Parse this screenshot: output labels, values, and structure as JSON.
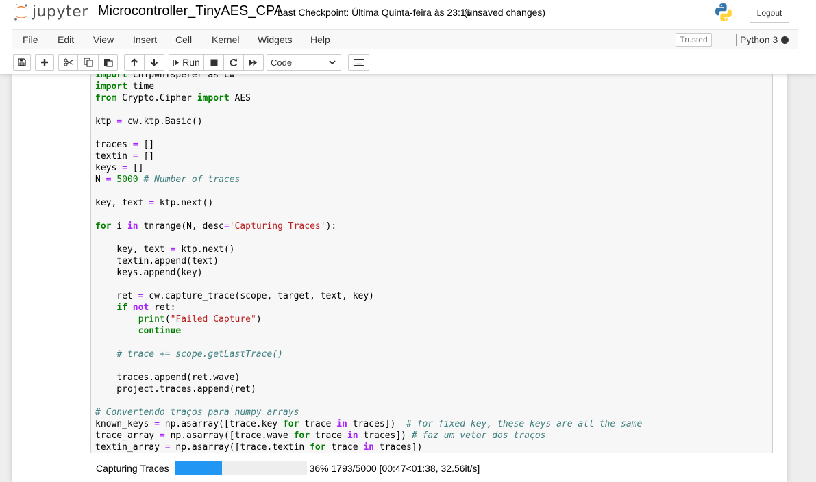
{
  "header": {
    "logo_text": "jupyter",
    "notebook_name": "Microcontroller_TinyAES_CPA",
    "checkpoint": "Last Checkpoint: Última Quinta-feira às 23:16",
    "unsaved": "(unsaved changes)",
    "logout_label": "Logout"
  },
  "menubar": {
    "items": [
      "File",
      "Edit",
      "View",
      "Insert",
      "Cell",
      "Kernel",
      "Widgets",
      "Help"
    ],
    "trusted_label": "Trusted",
    "kernel_name": "Python 3"
  },
  "toolbar": {
    "run_label": "Run",
    "cell_type": "Code",
    "icons": [
      "save-icon",
      "plus-icon",
      "cut-icon",
      "copy-icon",
      "paste-icon",
      "arrow-up-icon",
      "arrow-down-icon",
      "step-forward-icon",
      "stop-icon",
      "restart-icon",
      "fast-forward-icon",
      "chevron-down-icon",
      "keyboard-icon"
    ]
  },
  "colors": {
    "progress": "#2196f3",
    "keyword": "#008000",
    "operator": "#aa22ff",
    "string": "#ba2121",
    "comment": "#408080"
  },
  "code_lines": [
    "import chipwhisperer as cw",
    "import time",
    "from Crypto.Cipher import AES",
    "",
    "ktp = cw.ktp.Basic()",
    "",
    "traces = []",
    "textin = []",
    "keys = []",
    "N = 5000 # Number of traces",
    "",
    "key, text = ktp.next()",
    "",
    "for i in tnrange(N, desc='Capturing Traces'):",
    "",
    "    key, text = ktp.next()",
    "    textin.append(text)",
    "    keys.append(key)",
    "",
    "    ret = cw.capture_trace(scope, target, text, key)",
    "    if not ret:",
    "        print(\"Failed Capture\")",
    "        continue",
    "",
    "    # trace += scope.getLastTrace()",
    "",
    "    traces.append(ret.wave)",
    "    project.traces.append(ret)",
    "",
    "# Convertendo traços para numpy arrays",
    "known_keys = np.asarray([trace.key for trace in traces])  # for fixed key, these keys are all the same",
    "trace_array = np.asarray([trace.wave for trace in traces]) # faz um vetor dos traços",
    "textin_array = np.asarray([trace.textin for trace in traces])"
  ],
  "output": {
    "label": "Capturing Traces",
    "progress_fraction": 0.3586,
    "progress_text": "36% 1793/5000 [00:47<01:38, 32.56it/s]"
  }
}
